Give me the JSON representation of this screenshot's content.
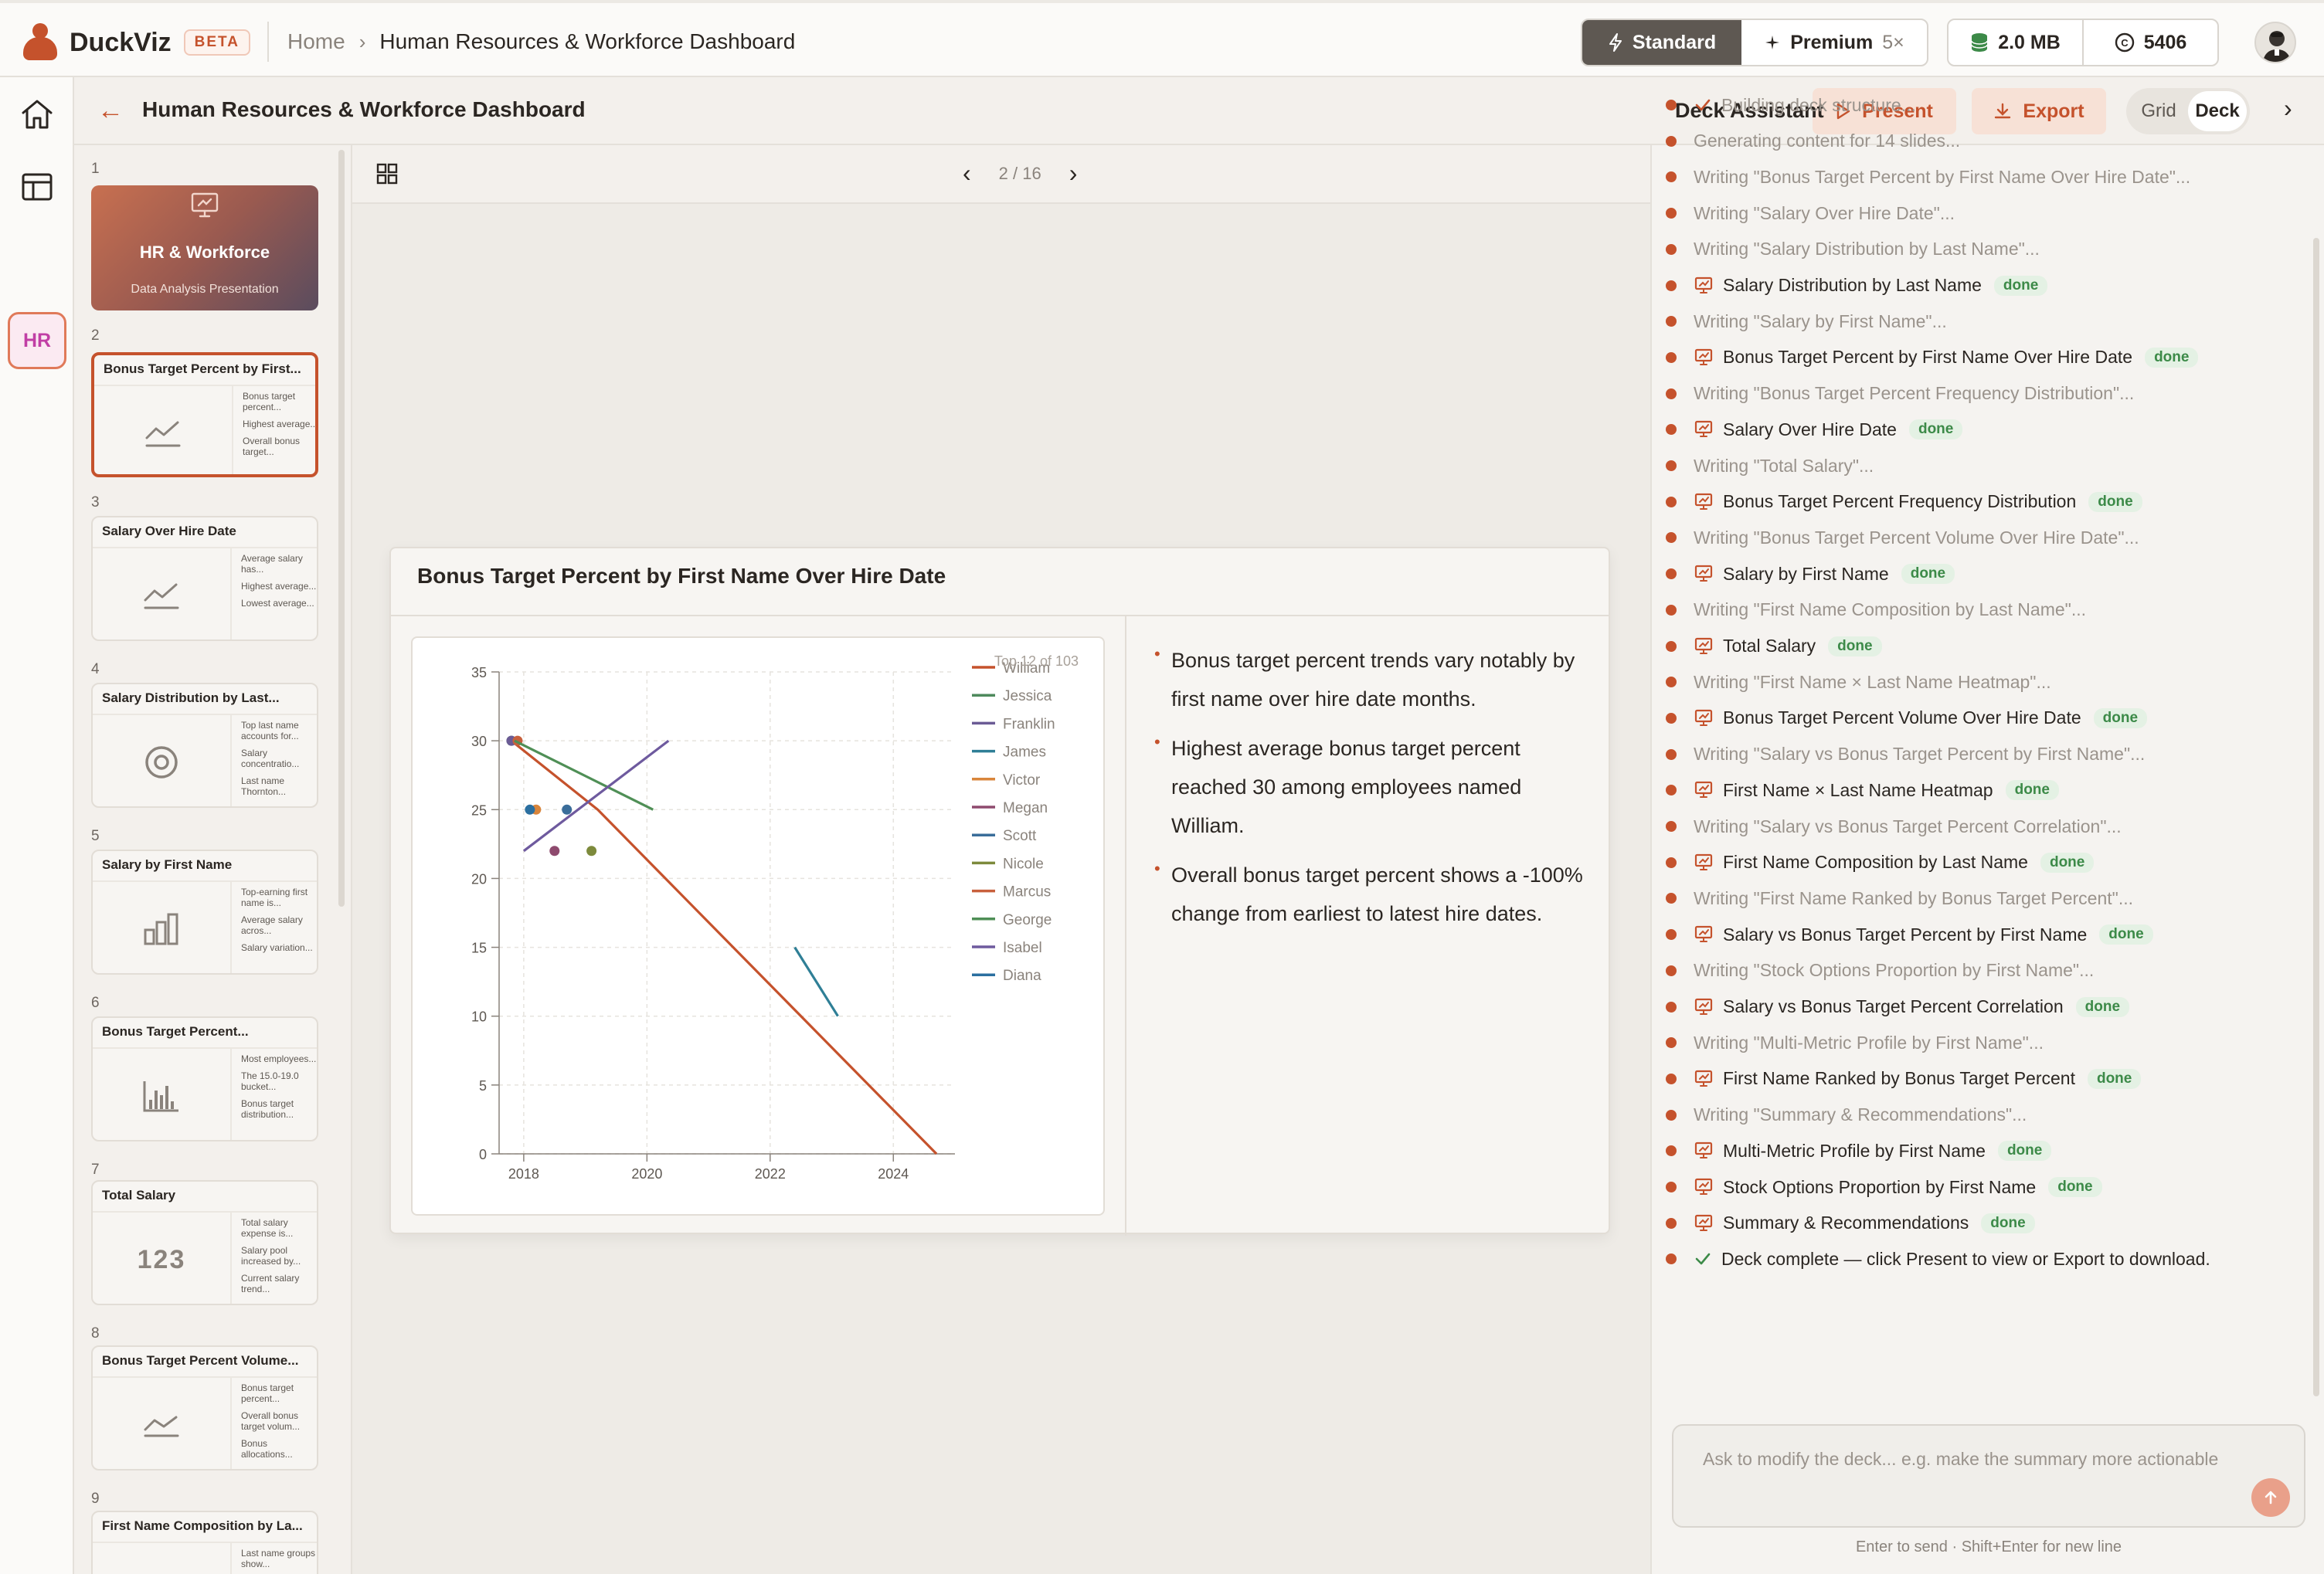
{
  "app": {
    "name": "DuckViz",
    "badge": "BETA"
  },
  "breadcrumb": {
    "home": "Home",
    "current": "Human Resources & Workforce Dashboard"
  },
  "plan": {
    "standard": "Standard",
    "premium": "Premium",
    "premium_mult": "5×"
  },
  "usage": {
    "storage": "2.0 MB",
    "credits": "5406"
  },
  "rail": {
    "hr_label": "HR"
  },
  "subbar": {
    "title": "Human Resources & Workforce Dashboard",
    "present": "Present",
    "export": "Export",
    "grid": "Grid",
    "deck": "Deck"
  },
  "pager": {
    "label": "2 / 16"
  },
  "slides": [
    {
      "num": "1",
      "title": "HR & Workforce",
      "subtitle": "Data Analysis Presentation",
      "kind": "cover"
    },
    {
      "num": "2",
      "title": "Bonus Target Percent by First...",
      "icon": "line",
      "bullets": [
        "Bonus target percent...",
        "Highest average...",
        "Overall bonus target..."
      ]
    },
    {
      "num": "3",
      "title": "Salary Over Hire Date",
      "icon": "line",
      "bullets": [
        "Average salary has...",
        "Highest average...",
        "Lowest average..."
      ]
    },
    {
      "num": "4",
      "title": "Salary Distribution by Last...",
      "icon": "donut",
      "bullets": [
        "Top last name accounts for...",
        "Salary concentratio...",
        "Last name Thornton..."
      ]
    },
    {
      "num": "5",
      "title": "Salary by First Name",
      "icon": "bar",
      "bullets": [
        "Top-earning first name is...",
        "Average salary acros...",
        "Salary variation..."
      ]
    },
    {
      "num": "6",
      "title": "Bonus Target Percent...",
      "icon": "histogram",
      "bullets": [
        "Most employees...",
        "The 15.0-19.0 bucket...",
        "Bonus target distribution..."
      ]
    },
    {
      "num": "7",
      "title": "Total Salary",
      "icon": "kpi",
      "kpi": "123",
      "bullets": [
        "Total salary expense is...",
        "Salary pool increased by...",
        "Current salary trend..."
      ]
    },
    {
      "num": "8",
      "title": "Bonus Target Percent Volume...",
      "icon": "area",
      "bullets": [
        "Bonus target percent...",
        "Overall bonus target volum...",
        "Bonus allocations..."
      ]
    },
    {
      "num": "9",
      "title": "First Name Composition by La...",
      "icon": "donut",
      "bullets": [
        "Last name groups show..."
      ]
    }
  ],
  "main_slide": {
    "title": "Bonus Target Percent by First Name Over Hire Date",
    "bullets": [
      "Bonus target percent trends vary notably by first name over hire date months.",
      "Highest average bonus target percent reached 30 among employees named William.",
      "Overall bonus target percent shows a -100% change from earliest to latest hire dates."
    ]
  },
  "chart_data": {
    "type": "line",
    "title": "",
    "xlabel": "",
    "ylabel": "",
    "annotation": "Top 12 of 103",
    "xlim": [
      2017.6,
      2025.0
    ],
    "ylim": [
      0,
      35
    ],
    "x_ticks": [
      2018,
      2020,
      2022,
      2024
    ],
    "y_ticks": [
      0,
      5,
      10,
      15,
      20,
      25,
      30,
      35
    ],
    "grid": true,
    "legend_position": "right",
    "series": [
      {
        "name": "William",
        "color": "#c5522c",
        "points": [
          [
            2017.8,
            30
          ],
          [
            2019.2,
            25
          ],
          [
            2024.7,
            0
          ]
        ]
      },
      {
        "name": "Jessica",
        "color": "#4e8a5c",
        "points": [
          [
            2017.8,
            30
          ]
        ]
      },
      {
        "name": "Franklin",
        "color": "#6b5b95",
        "points": [
          [
            2017.8,
            30
          ]
        ]
      },
      {
        "name": "James",
        "color": "#2f7f96",
        "points": [
          [
            2022.4,
            15
          ],
          [
            2023.1,
            10
          ]
        ]
      },
      {
        "name": "Victor",
        "color": "#d9853b",
        "points": [
          [
            2018.2,
            25
          ]
        ]
      },
      {
        "name": "Megan",
        "color": "#8e4a6e",
        "points": [
          [
            2018.5,
            22
          ]
        ]
      },
      {
        "name": "Scott",
        "color": "#3a6d9a",
        "points": [
          [
            2018.7,
            25
          ]
        ]
      },
      {
        "name": "Nicole",
        "color": "#7d8a3c",
        "points": [
          [
            2019.1,
            22
          ]
        ]
      },
      {
        "name": "Marcus",
        "color": "#c8603c",
        "points": [
          [
            2017.9,
            30
          ]
        ]
      },
      {
        "name": "George",
        "color": "#4f8f56",
        "points": [
          [
            2017.85,
            30
          ],
          [
            2020.1,
            25
          ]
        ]
      },
      {
        "name": "Isabel",
        "color": "#6e5a9e",
        "points": [
          [
            2018.0,
            22
          ],
          [
            2020.35,
            30
          ]
        ]
      },
      {
        "name": "Diana",
        "color": "#2b6fa0",
        "points": [
          [
            2018.1,
            25
          ]
        ]
      }
    ]
  },
  "assistant": {
    "title": "Deck Assistant",
    "items": [
      {
        "text": "Building deck structure...",
        "status": "pending",
        "check": true
      },
      {
        "text": "Generating content for 14 slides...",
        "status": "pending"
      },
      {
        "text": "Writing \"Bonus Target Percent by First Name Over Hire Date\"...",
        "status": "pending"
      },
      {
        "text": "Writing \"Salary Over Hire Date\"...",
        "status": "pending"
      },
      {
        "text": "Writing \"Salary Distribution by Last Name\"...",
        "status": "pending"
      },
      {
        "text": "Salary Distribution by Last Name",
        "status": "done",
        "badge": "done"
      },
      {
        "text": "Writing \"Salary by First Name\"...",
        "status": "pending"
      },
      {
        "text": "Bonus Target Percent by First Name Over Hire Date",
        "status": "done",
        "badge": "done"
      },
      {
        "text": "Writing \"Bonus Target Percent Frequency Distribution\"...",
        "status": "pending"
      },
      {
        "text": "Salary Over Hire Date",
        "status": "done",
        "badge": "done"
      },
      {
        "text": "Writing \"Total Salary\"...",
        "status": "pending"
      },
      {
        "text": "Bonus Target Percent Frequency Distribution",
        "status": "done",
        "badge": "done"
      },
      {
        "text": "Writing \"Bonus Target Percent Volume Over Hire Date\"...",
        "status": "pending"
      },
      {
        "text": "Salary by First Name",
        "status": "done",
        "badge": "done"
      },
      {
        "text": "Writing \"First Name Composition by Last Name\"...",
        "status": "pending"
      },
      {
        "text": "Total Salary",
        "status": "done",
        "badge": "done"
      },
      {
        "text": "Writing \"First Name × Last Name Heatmap\"...",
        "status": "pending"
      },
      {
        "text": "Bonus Target Percent Volume Over Hire Date",
        "status": "done",
        "badge": "done"
      },
      {
        "text": "Writing \"Salary vs Bonus Target Percent by First Name\"...",
        "status": "pending"
      },
      {
        "text": "First Name × Last Name Heatmap",
        "status": "done",
        "badge": "done"
      },
      {
        "text": "Writing \"Salary vs Bonus Target Percent Correlation\"...",
        "status": "pending"
      },
      {
        "text": "First Name Composition by Last Name",
        "status": "done",
        "badge": "done"
      },
      {
        "text": "Writing \"First Name Ranked by Bonus Target Percent\"...",
        "status": "pending"
      },
      {
        "text": "Salary vs Bonus Target Percent by First Name",
        "status": "done",
        "badge": "done"
      },
      {
        "text": "Writing \"Stock Options Proportion by First Name\"...",
        "status": "pending"
      },
      {
        "text": "Salary vs Bonus Target Percent Correlation",
        "status": "done",
        "badge": "done"
      },
      {
        "text": "Writing \"Multi-Metric Profile by First Name\"...",
        "status": "pending"
      },
      {
        "text": "First Name Ranked by Bonus Target Percent",
        "status": "done",
        "badge": "done"
      },
      {
        "text": "Writing \"Summary & Recommendations\"...",
        "status": "pending"
      },
      {
        "text": "Multi-Metric Profile by First Name",
        "status": "done",
        "badge": "done"
      },
      {
        "text": "Stock Options Proportion by First Name",
        "status": "done",
        "badge": "done"
      },
      {
        "text": "Summary & Recommendations",
        "status": "done",
        "badge": "done"
      },
      {
        "text": "Deck complete — click Present to view or Export to download.",
        "status": "complete"
      }
    ],
    "input_placeholder": "Ask to modify the deck... e.g. make the summary more actionable",
    "hint": "Enter to send · Shift+Enter for new line"
  },
  "colors": {
    "accent": "#c5522c",
    "done_badge_bg": "#e4f1e4",
    "done_badge_text": "#3c8a48"
  }
}
